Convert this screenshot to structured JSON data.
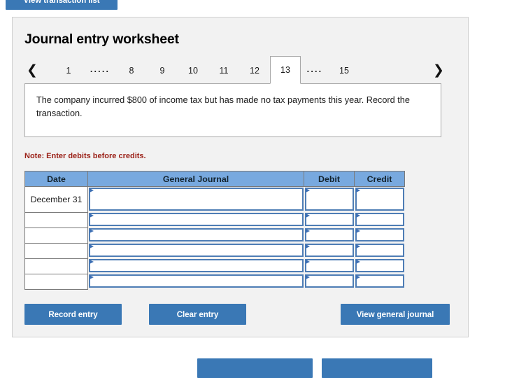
{
  "top_button": {
    "label": "View transaction list"
  },
  "panel": {
    "title": "Journal entry worksheet"
  },
  "tabs": {
    "prev_arrow_icon": "chevron-left-icon",
    "next_arrow_icon": "chevron-right-icon",
    "items": [
      {
        "label": "1",
        "type": "page",
        "active": false
      },
      {
        "label": ".....",
        "type": "ellipsis",
        "active": false
      },
      {
        "label": "8",
        "type": "page",
        "active": false
      },
      {
        "label": "9",
        "type": "page",
        "active": false
      },
      {
        "label": "10",
        "type": "page",
        "active": false
      },
      {
        "label": "11",
        "type": "page",
        "active": false
      },
      {
        "label": "12",
        "type": "page",
        "active": false
      },
      {
        "label": "13",
        "type": "page",
        "active": true
      },
      {
        "label": "....",
        "type": "ellipsis",
        "active": false
      },
      {
        "label": "15",
        "type": "page",
        "active": false
      }
    ],
    "active_label": "13"
  },
  "description": {
    "text": "The company incurred $800 of income tax but has made no tax payments this year. Record the transaction."
  },
  "note": {
    "text": "Note: Enter debits before credits."
  },
  "table": {
    "headers": {
      "date": "Date",
      "general_journal": "General Journal",
      "debit": "Debit",
      "credit": "Credit"
    },
    "rows": [
      {
        "date": "December 31",
        "general_journal": "",
        "debit": "",
        "credit": ""
      },
      {
        "date": "",
        "general_journal": "",
        "debit": "",
        "credit": ""
      },
      {
        "date": "",
        "general_journal": "",
        "debit": "",
        "credit": ""
      },
      {
        "date": "",
        "general_journal": "",
        "debit": "",
        "credit": ""
      },
      {
        "date": "",
        "general_journal": "",
        "debit": "",
        "credit": ""
      },
      {
        "date": "",
        "general_journal": "",
        "debit": "",
        "credit": ""
      }
    ]
  },
  "buttons": {
    "record_entry": "Record entry",
    "clear_entry": "Clear entry",
    "view_general_journal": "View general journal"
  },
  "colors": {
    "button_blue": "#3A78B5",
    "table_header_blue": "#78A9DF",
    "input_border_blue": "#4E7DB5",
    "note_red": "#9B2118",
    "panel_bg": "#F2F2F2"
  }
}
